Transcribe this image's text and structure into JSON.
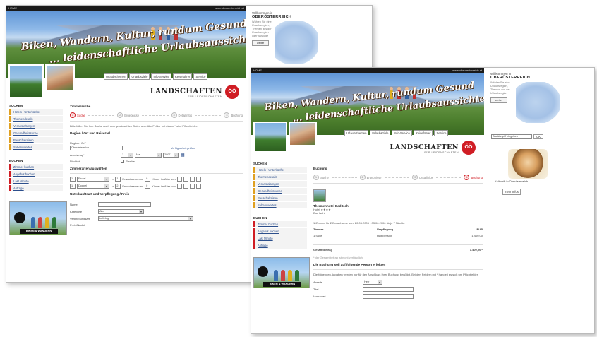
{
  "banner": {
    "slogan_line1": "Biken, Wandern, Kultur, rundum Gesund",
    "slogan_line2": "... leidenschaftliche Urlaubsaussichten!"
  },
  "topbar": {
    "left": "HOME",
    "right": "www.oberoesterreich.at"
  },
  "brand": {
    "name": "LANDSCHAFTEN",
    "sub": "FÜR LEIDENSCHAFTEN",
    "logo": "ÖÖ"
  },
  "nav_tabs": [
    "Urlaubsthemen",
    "Urlaubsziele",
    "Info-Service",
    "Reiseführer",
    "Service"
  ],
  "welcome": {
    "line1": "Willkommen in",
    "line2": "OBERÖSTERREICH",
    "lines": [
      "Wählen Sie eine",
      "Urlaubsregion,",
      "Themen aus der",
      "Urlaubsregion",
      "oder Ausflüge"
    ],
    "button": "weiter"
  },
  "sidebar": {
    "search_heading": "SUCHEN",
    "search_items": [
      "Hotels / Unterkünfte",
      "Themendetails",
      "Veranstaltungen",
      "Gesundheitssuche",
      "Pauschalreisen",
      "Sehenswertes"
    ],
    "book_heading": "BUCHEN",
    "book_items": [
      "Zimmer buchen",
      "Angebot buchen",
      "Last Minute",
      "Anfrage"
    ]
  },
  "promo": {
    "button": "BIKEN & WANDERN"
  },
  "form1": {
    "heading": "Zimmersuche",
    "steps": [
      "Suche",
      "Ergebnisse",
      "Detailinfos",
      "Buchung"
    ],
    "intro": "Bitte fullen Sie Ihre Suche nach den gewünschten Daten aus. Alle Felder mit einem * sind Pflichtfelder.",
    "section1": "Region / Ort und Reiseziel",
    "region_label": "Region / Ort*",
    "region_value": "Oberösterreich",
    "date_link": "Verfügbarkeit prüfen",
    "arrival_label": "Anreisetag*",
    "arrival_day": "1",
    "arrival_month": "Mai",
    "arrival_year": "2007",
    "nights_label": "Nächte*",
    "nights_opt": "Flexibel",
    "section2": "Zimmerarten auswählen",
    "room_rows": [
      {
        "count": "1",
        "type": "Einzel",
        "adults": "1",
        "adults_label": "Erwachsene und",
        "kids": "0",
        "kids_label": "Kinder im Alter von"
      },
      {
        "count": "1",
        "type": "Doppel",
        "adults": "2",
        "adults_label": "Erwachsene und",
        "kids": "0",
        "kids_label": "Kinder im Alter von"
      }
    ],
    "section3": "Unterkunftsart und Verpflegung / Preis",
    "name_label": "Name",
    "category_label": "Kategorie",
    "category_value": "Alle",
    "board_label": "Verpflegungsart",
    "board_value": "beliebig",
    "price_label": "Preis/Nacht"
  },
  "form2": {
    "heading": "Buchung",
    "steps": [
      "Suche",
      "Ergebnisse",
      "Detailinfos",
      "Buchung"
    ],
    "hotel_name": "Thermenhotel Bad Ischl",
    "hotel_cat": "Hotel ★★★★",
    "hotel_place": "Bad Ischl",
    "booking_text": "1 Zimmer für 2 Erwachsene vom 20.05.2006 - 03.06.2006 für je 7 Nächte",
    "table_headers": [
      "Zimmer",
      "Verpflegung",
      "EUR"
    ],
    "table_rows": [
      [
        "1 Suite",
        "Halbpension",
        "1.400,00"
      ]
    ],
    "total_label": "Gesamtbetrag",
    "total_value": "1.400,00 *",
    "note": "* der Gesamtbetrag ist nicht verbindlich",
    "section": "Die Buchung soll auf folgende Person erfolgen",
    "para": "Die folgenden Angaben werden nur für den Abschluss Ihrer Buchung benötigt. Bei den Feldern mit * handelt es sich um Pflichtfelder.",
    "fields": [
      {
        "label": "Anrede",
        "value": "Herr"
      },
      {
        "label": "Titel",
        "value": ""
      },
      {
        "label": "Vorname*",
        "value": ""
      }
    ]
  },
  "search_box": {
    "placeholder": "Suchbegriff eingeben",
    "button": "OK"
  },
  "food_ad": {
    "label": "Kulinarik in Oberösterreich",
    "button": "mehr Infos"
  }
}
